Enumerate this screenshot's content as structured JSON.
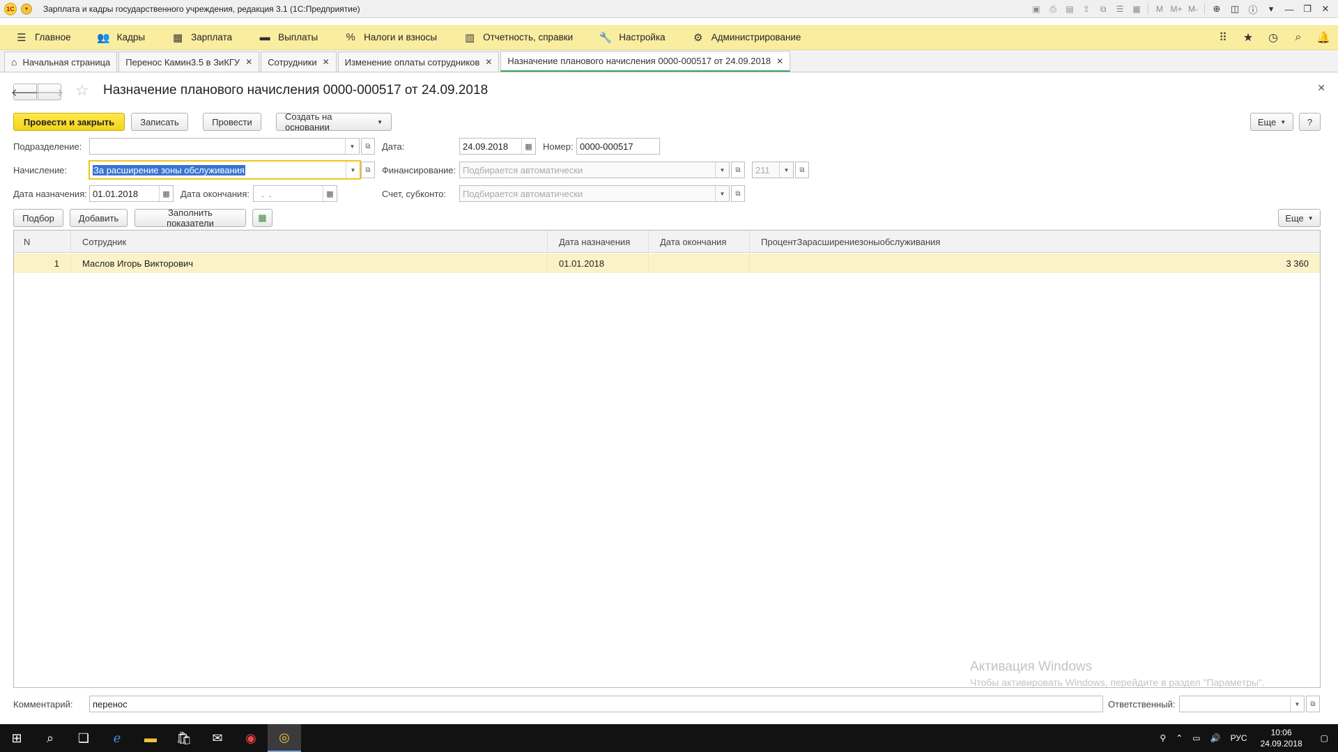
{
  "window": {
    "title": "Зарплата и кадры государственного учреждения, редакция 3.1  (1С:Предприятие)",
    "logo_text": "1С"
  },
  "sections": [
    {
      "label": "Главное",
      "icon": "menu-icon"
    },
    {
      "label": "Кадры",
      "icon": "people-icon"
    },
    {
      "label": "Зарплата",
      "icon": "calculator-icon"
    },
    {
      "label": "Выплаты",
      "icon": "wallet-icon"
    },
    {
      "label": "Налоги и взносы",
      "icon": "percent-icon"
    },
    {
      "label": "Отчетность, справки",
      "icon": "reports-icon"
    },
    {
      "label": "Настройка",
      "icon": "wrench-icon"
    },
    {
      "label": "Администрирование",
      "icon": "gear-icon"
    }
  ],
  "tabs": [
    {
      "label": "Начальная страница",
      "closable": false
    },
    {
      "label": "Перенос Камин3.5 в ЗиКГУ",
      "closable": true
    },
    {
      "label": "Сотрудники",
      "closable": true
    },
    {
      "label": "Изменение оплаты сотрудников",
      "closable": true
    },
    {
      "label": "Назначение планового начисления 0000-000517 от 24.09.2018",
      "closable": true,
      "active": true
    }
  ],
  "form": {
    "title": "Назначение планового начисления 0000-000517 от 24.09.2018",
    "buttons": {
      "post_close": "Провести и закрыть",
      "save": "Записать",
      "post": "Провести",
      "create_based": "Создать на основании",
      "more": "Еще",
      "help": "?"
    },
    "fields": {
      "department_label": "Подразделение:",
      "department_value": "",
      "date_label": "Дата:",
      "date_value": "24.09.2018",
      "number_label": "Номер:",
      "number_value": "0000-000517",
      "accrual_label": "Начисление:",
      "accrual_value": "За расширение зоны обслуживания",
      "financing_label": "Финансирование:",
      "financing_placeholder": "Подбирается автоматически",
      "kosgu_value": "211",
      "start_date_label": "Дата назначения:",
      "start_date_value": "01.01.2018",
      "end_date_label": "Дата окончания:",
      "end_date_value": "  .  .",
      "account_label": "Счет, субконто:",
      "account_placeholder": "Подбирается автоматически"
    },
    "table_toolbar": {
      "select": "Подбор",
      "add": "Добавить",
      "fill": "Заполнить показатели",
      "more": "Еще"
    },
    "table": {
      "columns": [
        "N",
        "Сотрудник",
        "Дата назначения",
        "Дата окончания",
        "ПроцентЗарасширениезоныобслуживания"
      ],
      "rows": [
        {
          "n": "1",
          "employee": "Маслов Игорь Викторович",
          "start": "01.01.2018",
          "end": "",
          "value": "3 360"
        }
      ]
    },
    "comment_label": "Комментарий:",
    "comment_value": "перенос",
    "responsible_label": "Ответственный:",
    "responsible_value": ""
  },
  "watermark": {
    "line1": "Активация Windows",
    "line2": "Чтобы активировать Windows, перейдите в раздел \"Параметры\"."
  },
  "taskbar": {
    "lang": "РУС",
    "time": "10:06",
    "date": "24.09.2018"
  }
}
